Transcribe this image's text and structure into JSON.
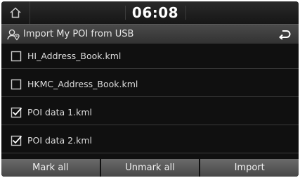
{
  "status_bar": {
    "time": "06:08",
    "home_icon": "home-icon"
  },
  "title_bar": {
    "title": "Import My POI from USB",
    "title_icon": "poi-person-icon",
    "back_icon": "back-arrow-icon"
  },
  "files": [
    {
      "name": "HI_Address_Book.kml",
      "checked": false
    },
    {
      "name": "HKMC_Address_Book.kml",
      "checked": false
    },
    {
      "name": "POI data 1.kml",
      "checked": true
    },
    {
      "name": "POI data 2.kml",
      "checked": true
    }
  ],
  "buttons": {
    "mark_all": "Mark all",
    "unmark_all": "Unmark all",
    "import": "Import"
  }
}
